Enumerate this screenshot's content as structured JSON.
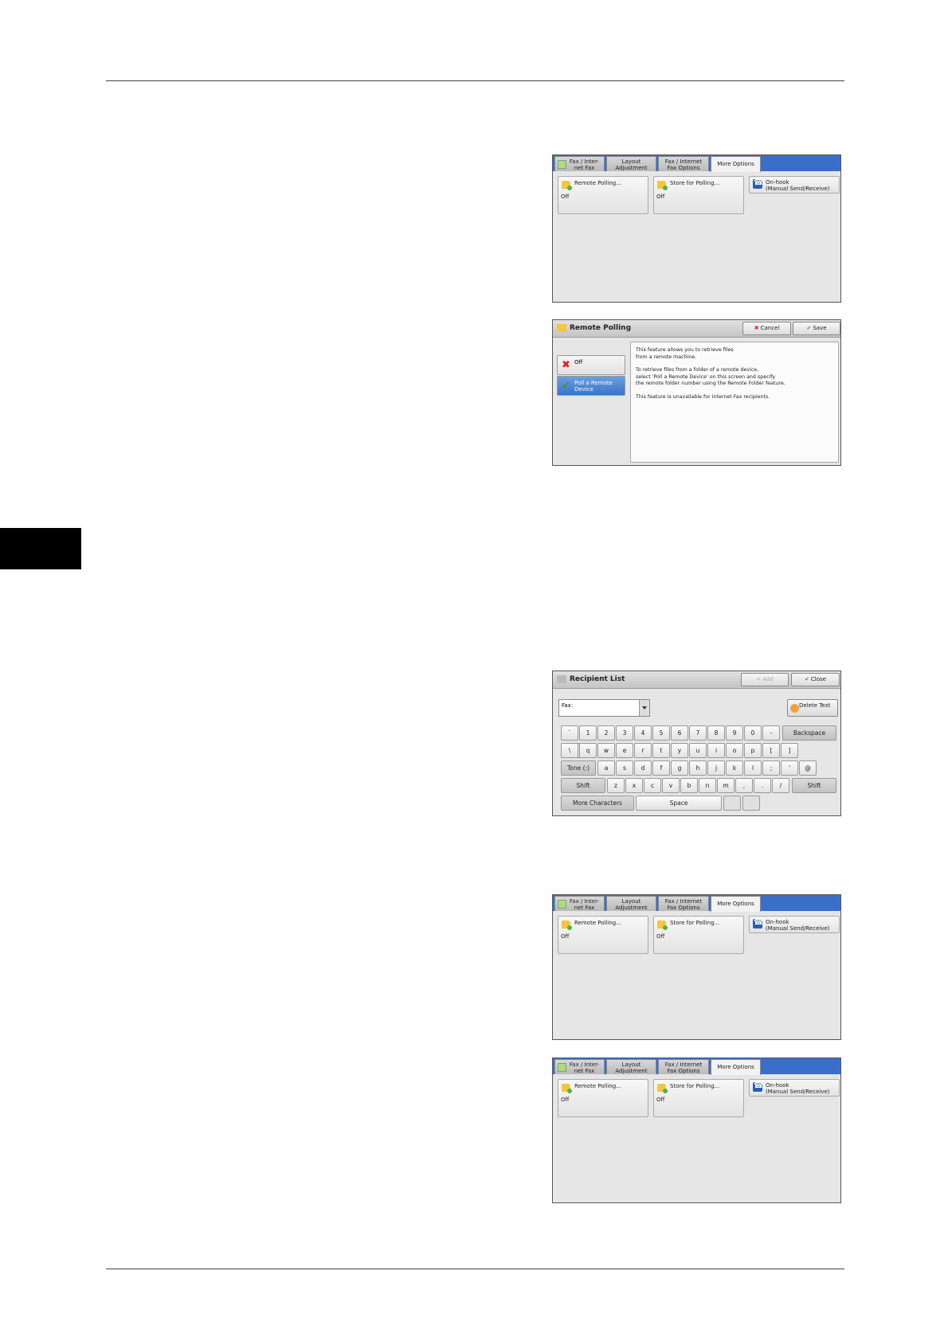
{
  "tabs": {
    "fax": "Fax / Inter-\nnet Fax",
    "layout": "Layout\nAdjustment",
    "options": "Fax / Internet\nFax Options",
    "more": "More Options"
  },
  "more_options": {
    "remote_polling": {
      "label": "Remote Polling...",
      "value": "Off"
    },
    "store_for_polling": {
      "label": "Store for Polling...",
      "value": "Off"
    },
    "on_hook": {
      "label": "On-hook\n(Manual Send/Receive)"
    }
  },
  "remote_polling_dialog": {
    "title": "Remote Polling",
    "cancel": "Cancel",
    "save": "Save",
    "off": "Off",
    "poll_device": "Poll a Remote\nDevice",
    "info": [
      "This feature allows you to retrieve files\nfrom a remote machine.",
      "To retrieve files from a folder of a remote device,\nselect 'Poll a Remote Device' on this screen and specify\nthe remote folder number using the Remote Folder feature.",
      "This feature is unavailable for Internet Fax recipients."
    ]
  },
  "recipient_list": {
    "title": "Recipient List",
    "add": "+ Add",
    "close": "Close",
    "fax_label": "Fax:",
    "delete_text": "Delete Text",
    "row1": [
      "`",
      "1",
      "2",
      "3",
      "4",
      "5",
      "6",
      "7",
      "8",
      "9",
      "0",
      "-"
    ],
    "backspace": "Backspace",
    "row2": [
      "\\",
      "q",
      "w",
      "e",
      "r",
      "t",
      "y",
      "u",
      "i",
      "o",
      "p",
      "[",
      "]"
    ],
    "tone": "Tone (:)",
    "row3": [
      "a",
      "s",
      "d",
      "f",
      "g",
      "h",
      "j",
      "k",
      "l",
      ";",
      "'",
      "@"
    ],
    "shift": "Shift",
    "row4": [
      "z",
      "x",
      "c",
      "v",
      "b",
      "n",
      "m",
      ",",
      ".",
      "/"
    ],
    "more_characters": "More Characters",
    "space": "Space"
  }
}
